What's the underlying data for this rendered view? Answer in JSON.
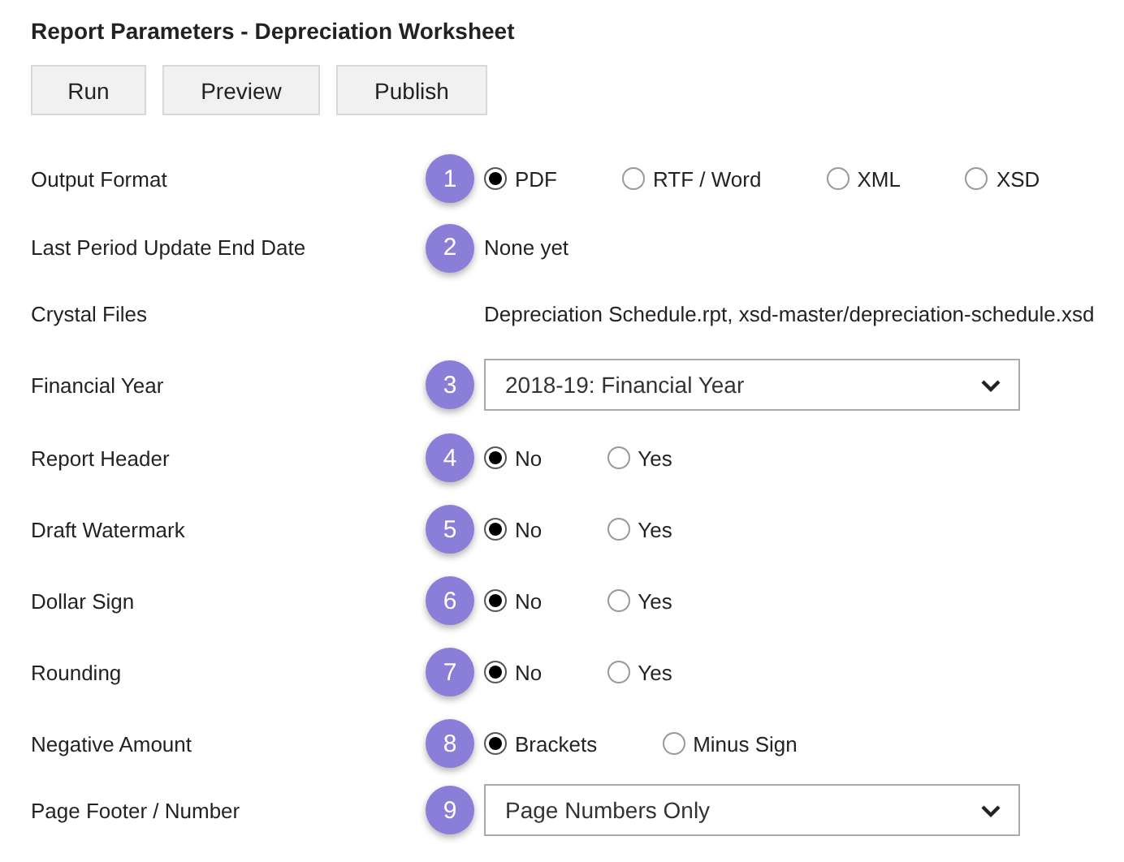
{
  "title": "Report Parameters - Depreciation Worksheet",
  "buttons": [
    "Run",
    "Preview",
    "Publish"
  ],
  "rows": [
    {
      "label": "Output Format",
      "badge": "1",
      "kind": "radio",
      "options": [
        {
          "label": "PDF",
          "selected": true
        },
        {
          "label": "RTF / Word",
          "selected": false
        },
        {
          "label": "XML",
          "selected": false
        },
        {
          "label": "XSD",
          "selected": false
        }
      ]
    },
    {
      "label": "Last Period Update End Date",
      "badge": "2",
      "kind": "text",
      "value": "None yet"
    },
    {
      "label": "Crystal Files",
      "kind": "text",
      "value": "Depreciation Schedule.rpt, xsd-master/depreciation-schedule.xsd"
    },
    {
      "label": "Financial Year",
      "badge": "3",
      "kind": "select",
      "value": "2018-19: Financial Year"
    },
    {
      "label": "Report Header",
      "badge": "4",
      "kind": "radio",
      "options": [
        {
          "label": "No",
          "selected": true
        },
        {
          "label": "Yes",
          "selected": false
        }
      ]
    },
    {
      "label": "Draft Watermark",
      "badge": "5",
      "kind": "radio",
      "options": [
        {
          "label": "No",
          "selected": true
        },
        {
          "label": "Yes",
          "selected": false
        }
      ]
    },
    {
      "label": "Dollar Sign",
      "badge": "6",
      "kind": "radio",
      "options": [
        {
          "label": "No",
          "selected": true
        },
        {
          "label": "Yes",
          "selected": false
        }
      ]
    },
    {
      "label": "Rounding",
      "badge": "7",
      "kind": "radio",
      "options": [
        {
          "label": "No",
          "selected": true
        },
        {
          "label": "Yes",
          "selected": false
        }
      ]
    },
    {
      "label": "Negative Amount",
      "badge": "8",
      "kind": "radio",
      "options": [
        {
          "label": "Brackets",
          "selected": true
        },
        {
          "label": "Minus Sign",
          "selected": false
        }
      ]
    },
    {
      "label": "Page Footer / Number",
      "badge": "9",
      "kind": "select",
      "value": "Page Numbers Only"
    }
  ]
}
